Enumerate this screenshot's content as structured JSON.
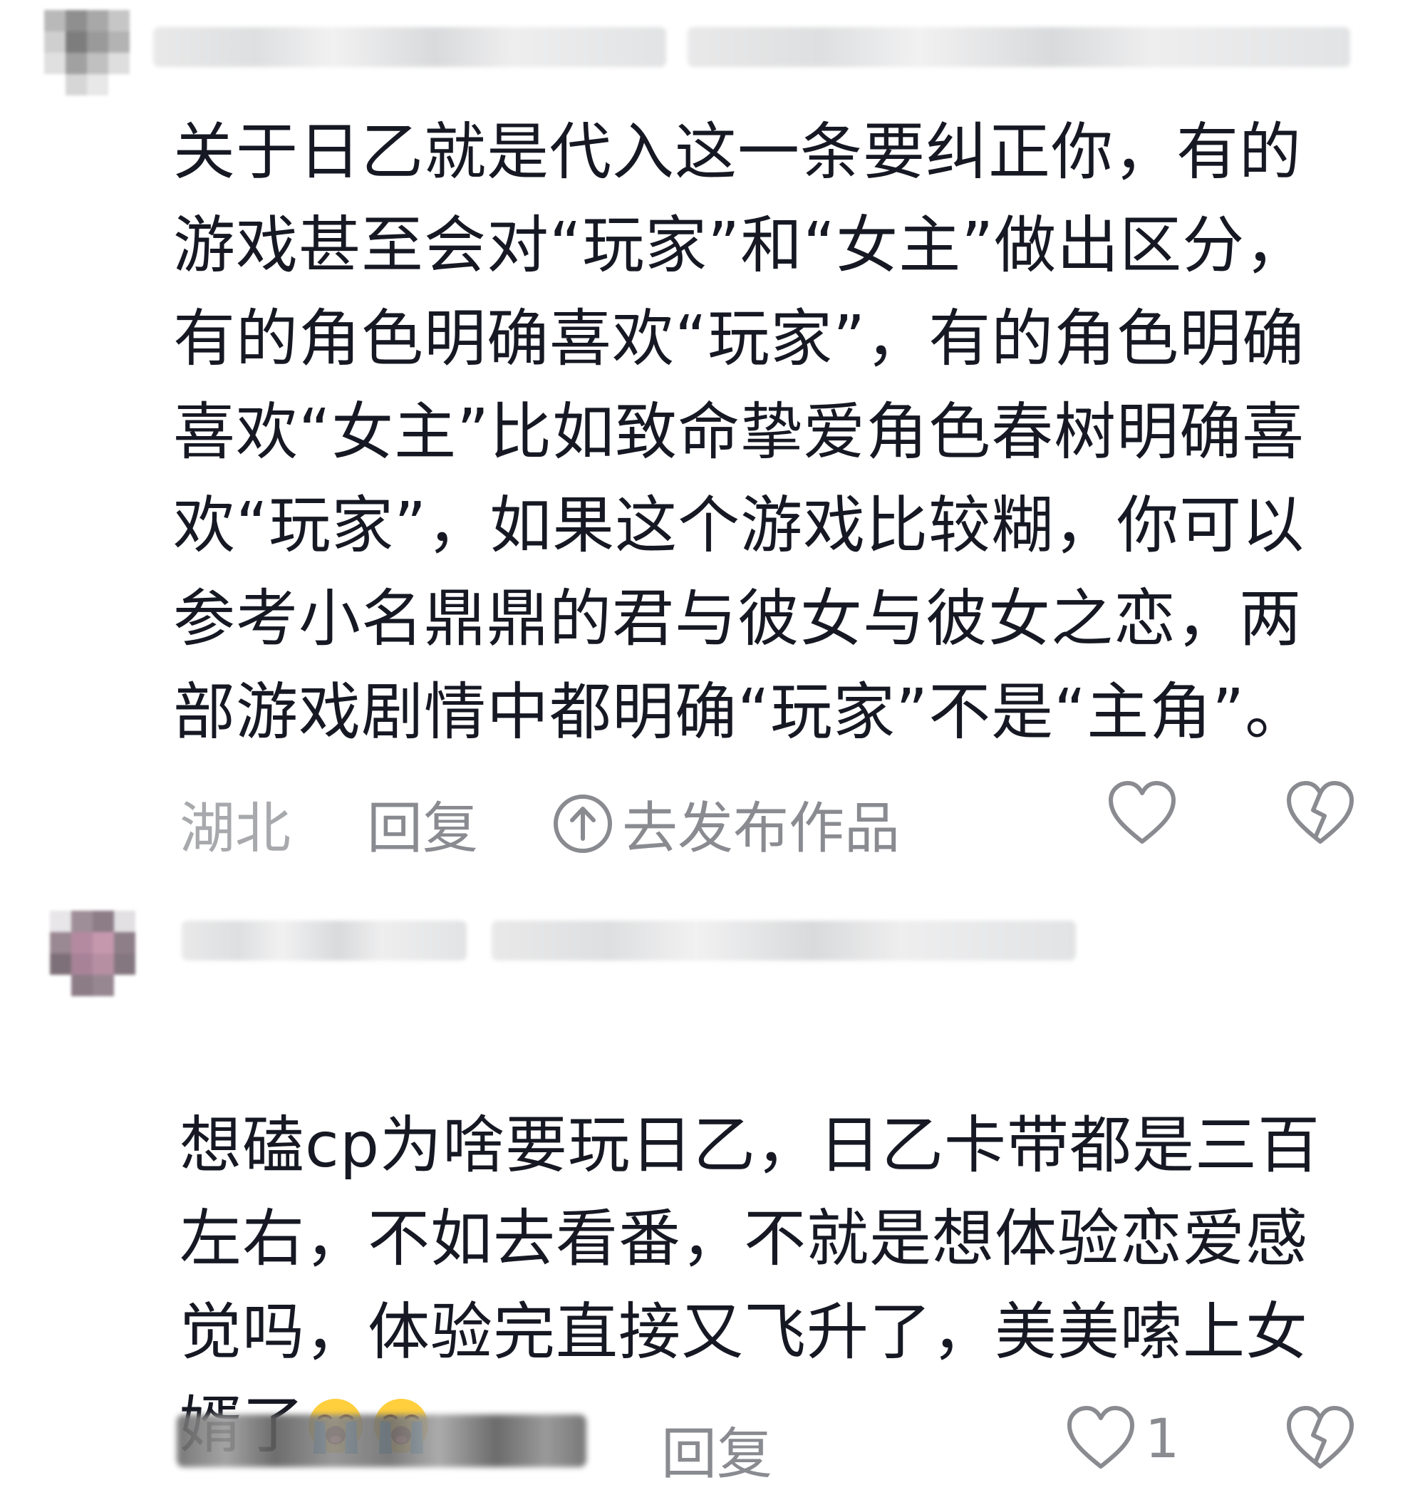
{
  "comments": [
    {
      "text": "关于日乙就是代入这一条要纠正你，有的\n游戏甚至会对“玩家”和“女主”做出区分，\n有的角色明确喜欢“玩家”，有的角色明确\n喜欢“女主”比如致命挚爱角色春树明确喜\n欢“玩家”，如果这个游戏比较糊，你可以\n参考小名鼎鼎的君与彼女与彼女之恋，两\n部游戏剧情中都明确“玩家”不是“主角”。",
      "location": "湖北",
      "reply_label": "回复",
      "share_label": "去发布作品"
    },
    {
      "text": "想磕cp为啥要玩日乙，日乙卡带都是三百\n左右，不如去看番，不就是想体验恋爱感\n觉吗，体验完直接又飞升了，美美嗦上女\n婿了",
      "reply_label": "回复",
      "like_count": "1"
    }
  ],
  "icons": {
    "like": "heart-outline-icon",
    "dislike": "broken-heart-icon",
    "share": "arrow-up-circle-icon",
    "emoji": "loudly-crying-face-emoji"
  },
  "colors": {
    "text": "#161823",
    "meta": "#8a8b91",
    "location": "#a8a9ad"
  }
}
